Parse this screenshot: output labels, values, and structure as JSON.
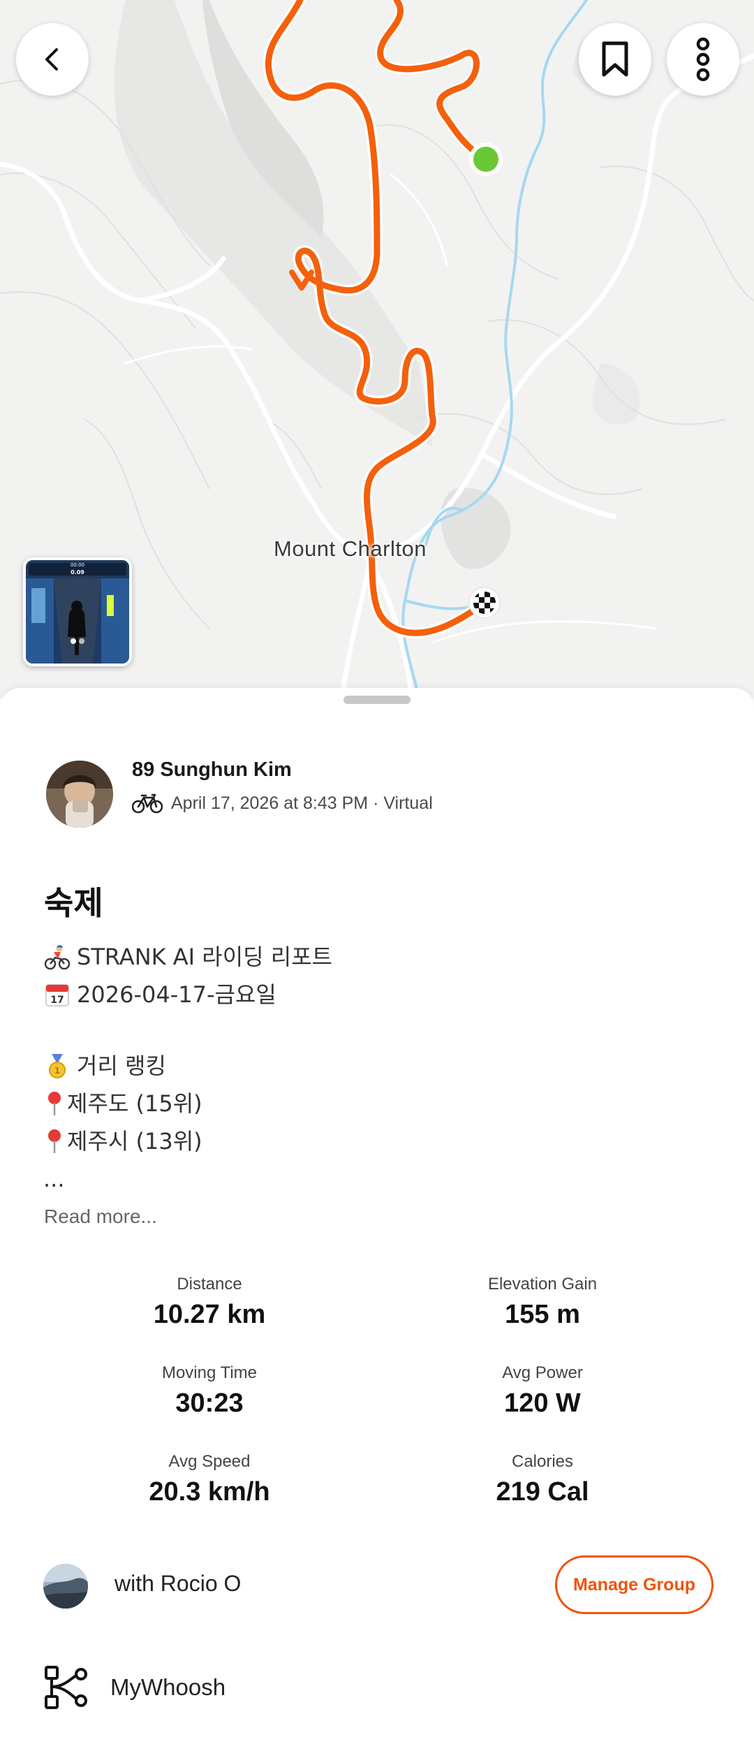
{
  "map": {
    "place_label": "Mount Charlton",
    "route_color": "#f4600c",
    "start_color": "#6ac835",
    "water_color": "#9fd3ee"
  },
  "header": {
    "back_icon": "chevron-left-icon",
    "bookmark_icon": "bookmark-icon",
    "more_icon": "more-vertical-icon"
  },
  "athlete": {
    "name": "89 Sunghun Kim",
    "activity_icon": "bicycle-icon",
    "meta": "April 17, 2026 at 8:43 PM · Virtual"
  },
  "activity": {
    "title": "숙제",
    "description": [
      {
        "emoji": "🚴",
        "text": "STRANK AI 라이딩 리포트"
      },
      {
        "emoji": "📅",
        "text": "2026-04-17-금요일"
      },
      {
        "emoji": "",
        "text": ""
      },
      {
        "emoji": "🥇",
        "text": "거리 랭킹"
      },
      {
        "emoji": "📍",
        "text": "제주도 (15위)"
      },
      {
        "emoji": "📍",
        "text": "제주시 (13위)"
      },
      {
        "emoji": "",
        "text": "..."
      }
    ],
    "read_more": "Read more..."
  },
  "stats": [
    {
      "label": "Distance",
      "value": "10.27 km"
    },
    {
      "label": "Elevation Gain",
      "value": "155 m"
    },
    {
      "label": "Moving Time",
      "value": "30:23"
    },
    {
      "label": "Avg Power",
      "value": "120 W"
    },
    {
      "label": "Avg Speed",
      "value": "20.3 km/h"
    },
    {
      "label": "Calories",
      "value": "219 Cal"
    }
  ],
  "group": {
    "text": "with Rocio O",
    "button": "Manage Group"
  },
  "device": {
    "icon": "device-connections-icon",
    "name": "MyWhoosh"
  },
  "thumbnail": {
    "hud_time": "00:00",
    "hud_value": "0.09",
    "page_dots": 2
  }
}
